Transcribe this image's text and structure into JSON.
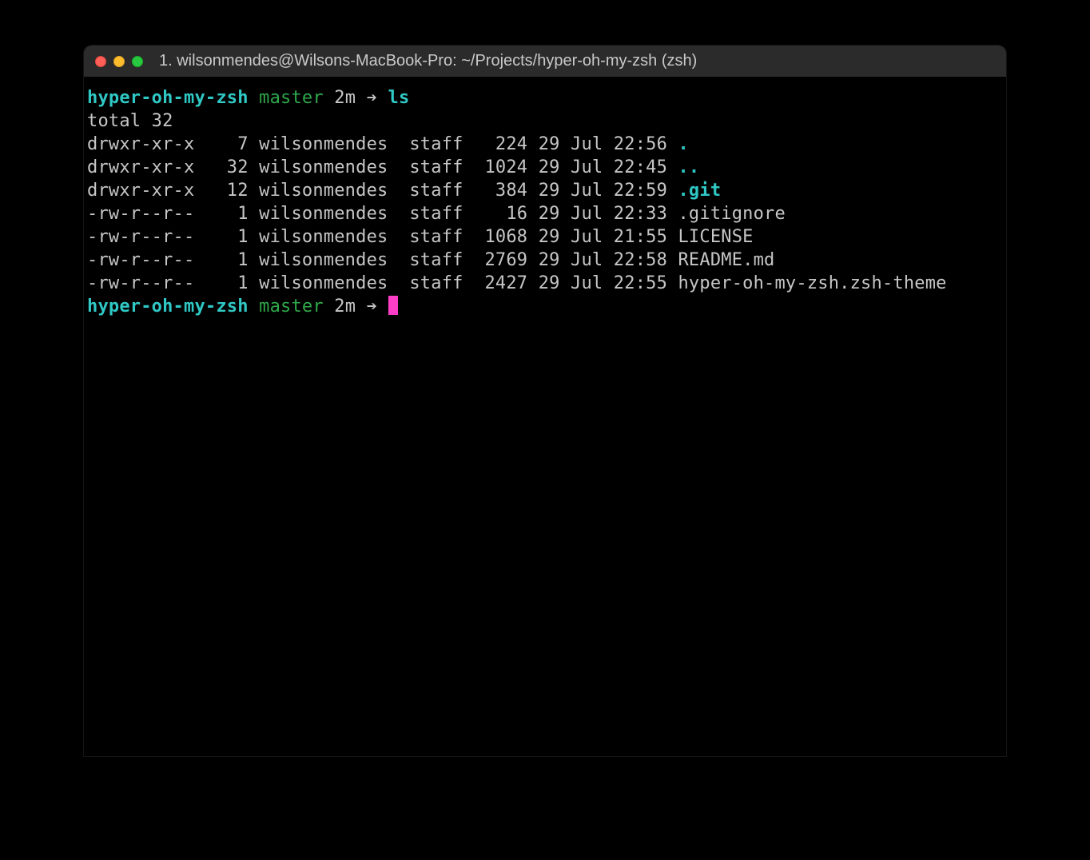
{
  "titlebar": {
    "title": "1. wilsonmendes@Wilsons-MacBook-Pro: ~/Projects/hyper-oh-my-zsh (zsh)"
  },
  "prompt1": {
    "dir": "hyper-oh-my-zsh",
    "branch": "master",
    "age": "2m",
    "arrow": "➔",
    "command": "ls"
  },
  "output": {
    "total": "total 32",
    "rows": [
      {
        "perm": "drwxr-xr-x",
        "links": "   7",
        "user": "wilsonmendes",
        "group": "staff",
        "size": "  224",
        "date": "29 Jul 22:56",
        "name": ".",
        "color": "cyanb"
      },
      {
        "perm": "drwxr-xr-x",
        "links": "  32",
        "user": "wilsonmendes",
        "group": "staff",
        "size": " 1024",
        "date": "29 Jul 22:45",
        "name": "..",
        "color": "cyanb"
      },
      {
        "perm": "drwxr-xr-x",
        "links": "  12",
        "user": "wilsonmendes",
        "group": "staff",
        "size": "  384",
        "date": "29 Jul 22:59",
        "name": ".git",
        "color": "cyanb"
      },
      {
        "perm": "-rw-r--r--",
        "links": "   1",
        "user": "wilsonmendes",
        "group": "staff",
        "size": "   16",
        "date": "29 Jul 22:33",
        "name": ".gitignore",
        "color": "whiteb"
      },
      {
        "perm": "-rw-r--r--",
        "links": "   1",
        "user": "wilsonmendes",
        "group": "staff",
        "size": " 1068",
        "date": "29 Jul 21:55",
        "name": "LICENSE",
        "color": "whiteb"
      },
      {
        "perm": "-rw-r--r--",
        "links": "   1",
        "user": "wilsonmendes",
        "group": "staff",
        "size": " 2769",
        "date": "29 Jul 22:58",
        "name": "README.md",
        "color": "whiteb"
      },
      {
        "perm": "-rw-r--r--",
        "links": "   1",
        "user": "wilsonmendes",
        "group": "staff",
        "size": " 2427",
        "date": "29 Jul 22:55",
        "name": "hyper-oh-my-zsh.zsh-theme",
        "color": "whiteb"
      }
    ]
  },
  "prompt2": {
    "dir": "hyper-oh-my-zsh",
    "branch": "master",
    "age": "2m",
    "arrow": "➔"
  }
}
